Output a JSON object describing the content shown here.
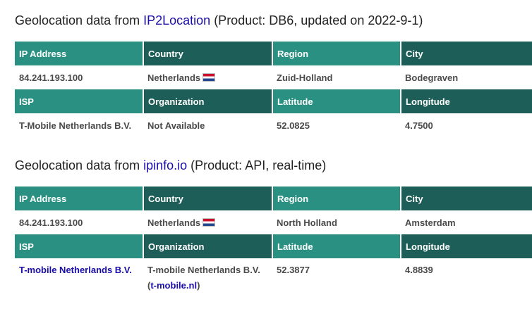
{
  "sections": [
    {
      "prefix": "Geolocation data from ",
      "source_link": "IP2Location",
      "suffix": " (Product: DB6, updated on 2022-9-1)",
      "headers": {
        "ip": "IP Address",
        "country": "Country",
        "region": "Region",
        "city": "City",
        "isp": "ISP",
        "organization": "Organization",
        "latitude": "Latitude",
        "longitude": "Longitude"
      },
      "values": {
        "ip": "84.241.193.100",
        "country": "Netherlands",
        "region": "Zuid-Holland",
        "city": "Bodegraven",
        "isp": "T-Mobile Netherlands B.V.",
        "organization": "Not Available",
        "latitude": "52.0825",
        "longitude": "4.7500"
      }
    },
    {
      "prefix": "Geolocation data from ",
      "source_link": "ipinfo.io",
      "suffix": " (Product: API, real-time)",
      "headers": {
        "ip": "IP Address",
        "country": "Country",
        "region": "Region",
        "city": "City",
        "isp": "ISP",
        "organization": "Organization",
        "latitude": "Latitude",
        "longitude": "Longitude"
      },
      "values": {
        "ip": "84.241.193.100",
        "country": "Netherlands",
        "region": "North Holland",
        "city": "Amsterdam",
        "isp": "T-mobile Netherlands B.V.",
        "organization": "T-mobile Netherlands B.V.",
        "organization_domain_open": "(",
        "organization_domain": "t-mobile.nl",
        "organization_domain_close": ")",
        "latitude": "52.3877",
        "longitude": "4.8839"
      }
    }
  ],
  "colors": {
    "header_dark": "#1e5e58",
    "header_light": "#2a9082",
    "link": "#1a0dab"
  },
  "icons": {
    "country_flag": "netherlands-flag-icon"
  }
}
